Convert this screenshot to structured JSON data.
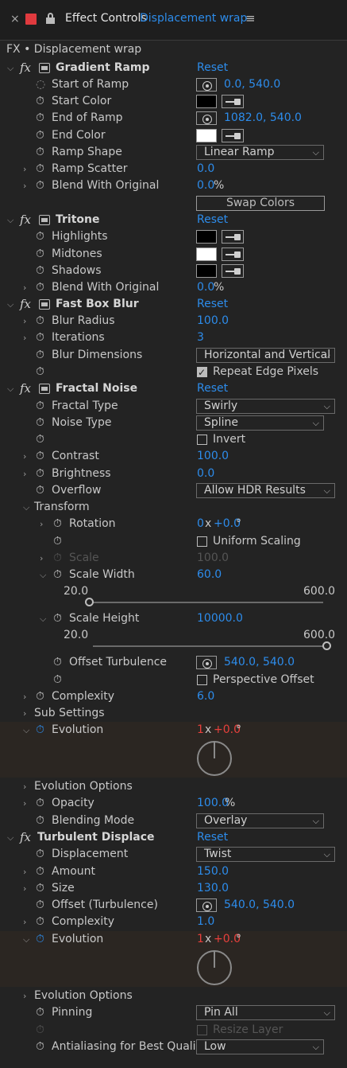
{
  "panel": {
    "close": "×",
    "title": "Effect Controls",
    "layer": "Displacement wrap",
    "menu": "≡",
    "breadcrumb": "FX • Displacement wrap",
    "accent_color": "#e03a3e"
  },
  "reset": "Reset",
  "gradient_ramp": {
    "name": "Gradient Ramp",
    "start_of_ramp": {
      "label": "Start of Ramp",
      "value": "0.0, 540.0"
    },
    "start_color": {
      "label": "Start Color",
      "swatch": "#000000"
    },
    "end_of_ramp": {
      "label": "End of Ramp",
      "value": "1082.0, 540.0"
    },
    "end_color": {
      "label": "End Color",
      "swatch": "#ffffff"
    },
    "ramp_shape": {
      "label": "Ramp Shape",
      "value": "Linear Ramp"
    },
    "ramp_scatter": {
      "label": "Ramp Scatter",
      "value": "0.0"
    },
    "blend": {
      "label": "Blend With Original",
      "value": "0.0",
      "unit": "%"
    },
    "swap_button": "Swap Colors"
  },
  "tritone": {
    "name": "Tritone",
    "highlights": {
      "label": "Highlights",
      "swatch": "#000000"
    },
    "midtones": {
      "label": "Midtones",
      "swatch": "#ffffff"
    },
    "shadows": {
      "label": "Shadows",
      "swatch": "#000000"
    },
    "blend": {
      "label": "Blend With Original",
      "value": "0.0",
      "unit": "%"
    }
  },
  "fast_box_blur": {
    "name": "Fast Box Blur",
    "blur_radius": {
      "label": "Blur Radius",
      "value": "100.0"
    },
    "iterations": {
      "label": "Iterations",
      "value": "3"
    },
    "blur_dimensions": {
      "label": "Blur Dimensions",
      "value": "Horizontal and Vertical"
    },
    "repeat_edge": {
      "label": "Repeat Edge Pixels",
      "checked": true
    }
  },
  "fractal_noise": {
    "name": "Fractal Noise",
    "fractal_type": {
      "label": "Fractal Type",
      "value": "Swirly"
    },
    "noise_type": {
      "label": "Noise Type",
      "value": "Spline"
    },
    "invert": {
      "label": "Invert",
      "checked": false
    },
    "contrast": {
      "label": "Contrast",
      "value": "100.0"
    },
    "brightness": {
      "label": "Brightness",
      "value": "0.0"
    },
    "overflow": {
      "label": "Overflow",
      "value": "Allow HDR Results"
    },
    "transform": {
      "label": "Transform",
      "rotation": {
        "label": "Rotation",
        "rev": "0",
        "x": "x",
        "deg": "+0.0",
        "unit": "°"
      },
      "uniform_scaling": {
        "label": "Uniform Scaling",
        "checked": false
      },
      "scale": {
        "label": "Scale",
        "value": "100.0"
      },
      "scale_width": {
        "label": "Scale Width",
        "value": "60.0",
        "min": "20.0",
        "max": "600.0"
      },
      "scale_height": {
        "label": "Scale Height",
        "value": "10000.0",
        "min": "20.0",
        "max": "600.0"
      },
      "offset_turbulence": {
        "label": "Offset Turbulence",
        "value": "540.0, 540.0"
      },
      "perspective_offset": {
        "label": "Perspective Offset",
        "checked": false
      }
    },
    "complexity": {
      "label": "Complexity",
      "value": "6.0"
    },
    "sub_settings": {
      "label": "Sub Settings"
    },
    "evolution": {
      "label": "Evolution",
      "rev": "1",
      "x": "x",
      "deg": "+0.0",
      "unit": "°"
    },
    "evolution_options": {
      "label": "Evolution Options"
    },
    "opacity": {
      "label": "Opacity",
      "value": "100.0",
      "unit": "%"
    },
    "blending_mode": {
      "label": "Blending Mode",
      "value": "Overlay"
    }
  },
  "turbulent_displace": {
    "name": "Turbulent Displace",
    "displacement": {
      "label": "Displacement",
      "value": "Twist"
    },
    "amount": {
      "label": "Amount",
      "value": "150.0"
    },
    "size": {
      "label": "Size",
      "value": "130.0"
    },
    "offset": {
      "label": "Offset (Turbulence)",
      "value": "540.0, 540.0"
    },
    "complexity": {
      "label": "Complexity",
      "value": "1.0"
    },
    "evolution": {
      "label": "Evolution",
      "rev": "1",
      "x": "x",
      "deg": "+0.0",
      "unit": "°"
    },
    "evolution_options": {
      "label": "Evolution Options"
    },
    "pinning": {
      "label": "Pinning",
      "value": "Pin All"
    },
    "resize_layer": {
      "label": "Resize Layer",
      "checked": false
    },
    "antialiasing": {
      "label": "Antialiasing for Best Quality",
      "value": "Low"
    }
  }
}
